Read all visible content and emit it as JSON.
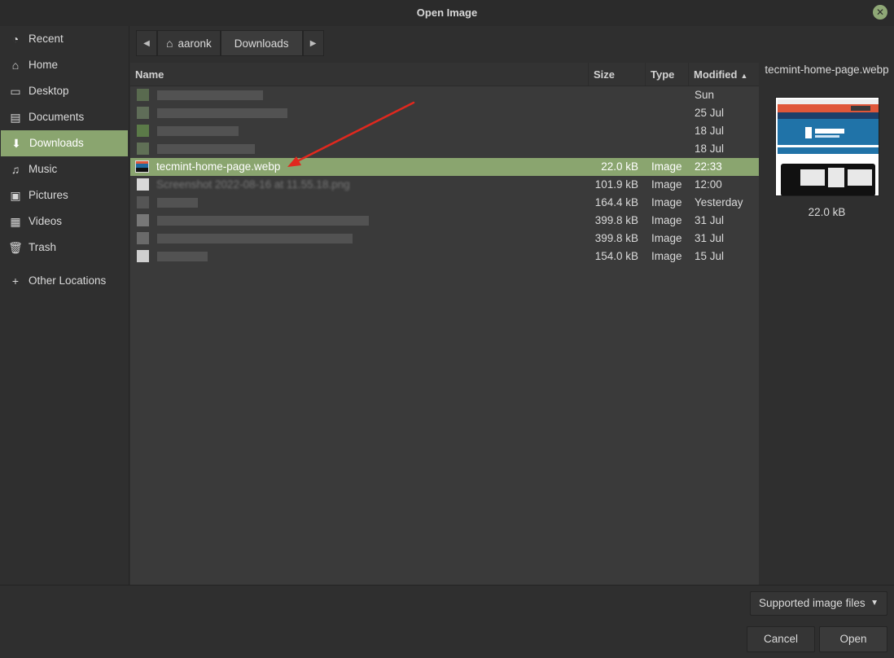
{
  "window": {
    "title": "Open Image"
  },
  "sidebar": {
    "items": [
      {
        "label": "Recent",
        "icon": "recent-icon"
      },
      {
        "label": "Home",
        "icon": "home-icon"
      },
      {
        "label": "Desktop",
        "icon": "desktop-icon"
      },
      {
        "label": "Documents",
        "icon": "documents-icon"
      },
      {
        "label": "Downloads",
        "icon": "downloads-icon",
        "active": true
      },
      {
        "label": "Music",
        "icon": "music-icon"
      },
      {
        "label": "Pictures",
        "icon": "pictures-icon"
      },
      {
        "label": "Videos",
        "icon": "videos-icon"
      },
      {
        "label": "Trash",
        "icon": "trash-icon"
      }
    ],
    "other_locations": "Other Locations"
  },
  "pathbar": {
    "home": "aaronk",
    "current": "Downloads"
  },
  "filelist": {
    "columns": {
      "name": "Name",
      "size": "Size",
      "type": "Type",
      "modified": "Modified"
    },
    "rows": [
      {
        "name": "",
        "size": "",
        "type": "",
        "modified": "Sun"
      },
      {
        "name": "",
        "size": "",
        "type": "",
        "modified": "25 Jul"
      },
      {
        "name": "",
        "size": "",
        "type": "",
        "modified": "18 Jul"
      },
      {
        "name": "",
        "size": "",
        "type": "",
        "modified": "18 Jul"
      },
      {
        "name": "tecmint-home-page.webp",
        "size": "22.0 kB",
        "type": "Image",
        "modified": "22:33",
        "selected": true
      },
      {
        "name": "Screenshot 2022-08-16 at 11.55.18.png",
        "size": "101.9 kB",
        "type": "Image",
        "modified": "12:00"
      },
      {
        "name": "",
        "size": "164.4 kB",
        "type": "Image",
        "modified": "Yesterday"
      },
      {
        "name": "",
        "size": "399.8 kB",
        "type": "Image",
        "modified": "31 Jul"
      },
      {
        "name": "",
        "size": "399.8 kB",
        "type": "Image",
        "modified": "31 Jul"
      },
      {
        "name": "",
        "size": "154.0 kB",
        "type": "Image",
        "modified": "15 Jul"
      }
    ]
  },
  "preview": {
    "filename": "tecmint-home-page.webp",
    "size": "22.0 kB"
  },
  "footer": {
    "filter": "Supported image files",
    "cancel": "Cancel",
    "open": "Open"
  },
  "colors": {
    "accent": "#8aa56f",
    "annotation_arrow": "#e0281e"
  }
}
